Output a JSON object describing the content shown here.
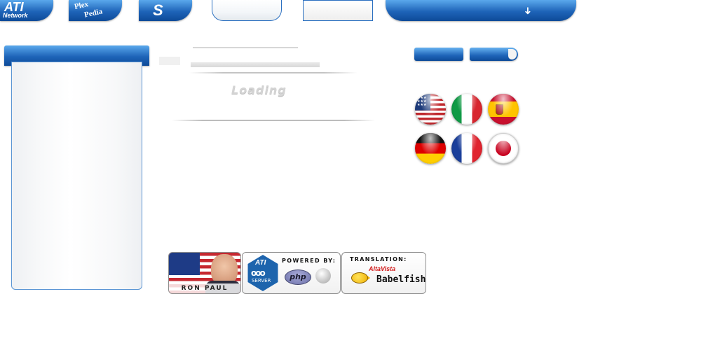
{
  "nav": {
    "ati_logo": "ATI",
    "ati_sub": "Network",
    "plex_a": "Plex",
    "plex_b": "Pedia",
    "s_logo": "S",
    "down_arrow": "➜"
  },
  "main": {
    "loading_text": "Loading"
  },
  "flags": [
    "United States",
    "Italy",
    "Spain",
    "Germany",
    "France",
    "Japan"
  ],
  "badges": {
    "ronpaul": "RON PAUL",
    "powered_title": "POWERED BY:",
    "powered_ati": "ATI",
    "powered_server": "SERVER",
    "powered_php": "php",
    "translation_title": "TRANSLATION:",
    "altavista": "AltaVista",
    "babelfish": "Babelfish"
  },
  "colors": {
    "accent_blue": "#1e64b8",
    "highlight_blue": "#5aa8ec",
    "border_blue": "#5b95d4"
  }
}
